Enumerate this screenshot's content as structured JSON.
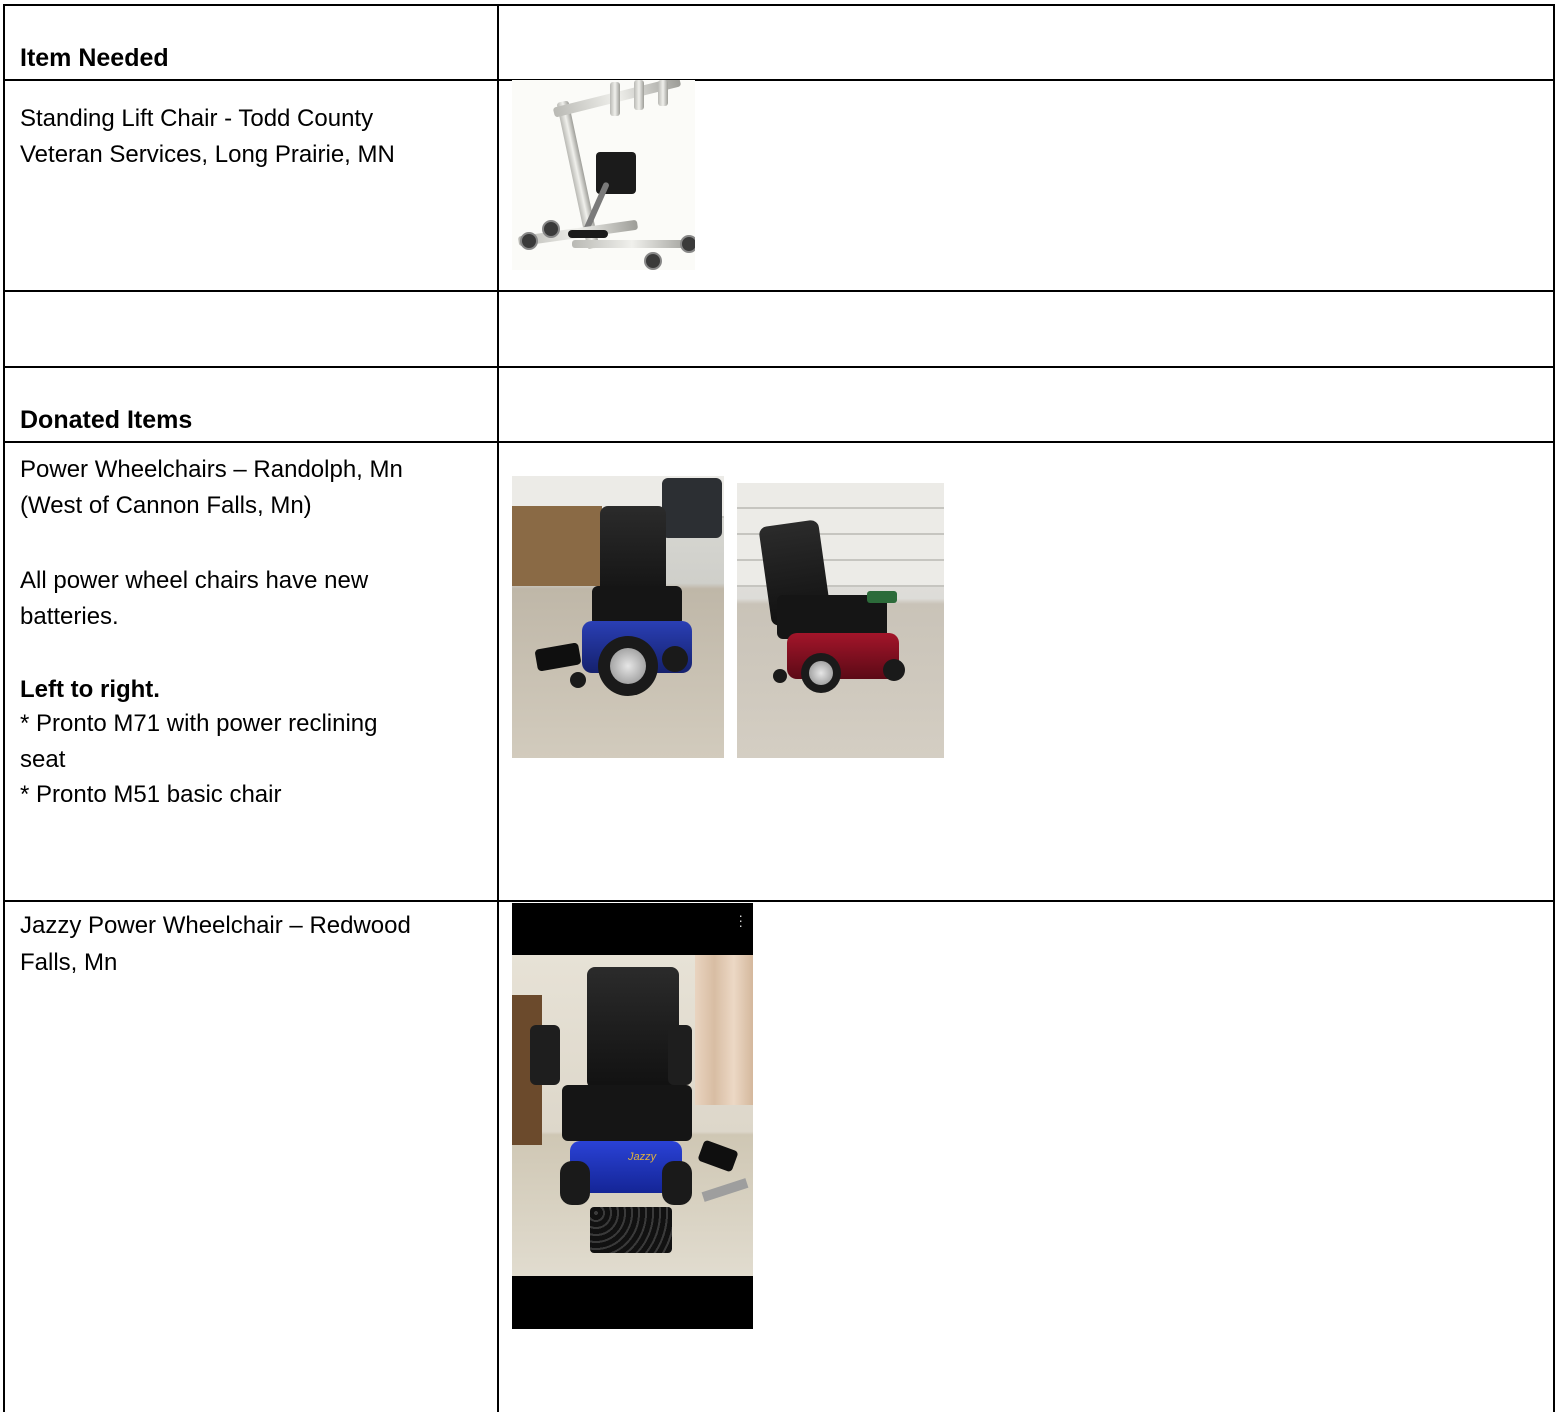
{
  "table": {
    "headings": {
      "item_needed": "Item Needed",
      "donated_items": "Donated Items"
    },
    "needed_items": [
      {
        "line1": "Standing Lift Chair - Todd County",
        "line2": "Veteran Services, Long Prairie, MN",
        "photo": "standing-lift-photo"
      }
    ],
    "donated": [
      {
        "lines": [
          "Power Wheelchairs – Randolph, Mn",
          "(West of Cannon Falls, Mn)",
          "",
          "All power wheel chairs have new",
          "batteries.",
          ""
        ],
        "bold_line": "Left to right.",
        "list_lines": [
          "* Pronto M71 with power reclining",
          "seat",
          "* Pronto M51 basic chair"
        ],
        "photos": [
          "pronto-m71-photo",
          "pronto-m51-photo"
        ]
      },
      {
        "lines": [
          "Jazzy Power Wheelchair – Redwood",
          "Falls, Mn"
        ],
        "photos": [
          "jazzy-wheelchair-photo"
        ],
        "photo_overlay_text": "Jazzy"
      }
    ]
  },
  "colors": {
    "border": "#000000",
    "pronto_m71_base": "#2a3fb5",
    "pronto_m51_base": "#a3152a",
    "jazzy_base": "#1f36c9"
  }
}
